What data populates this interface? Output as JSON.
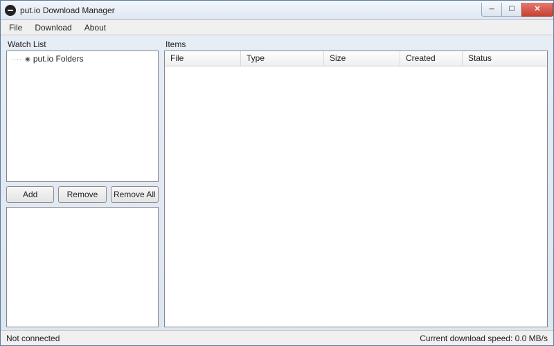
{
  "window": {
    "title": "put.io Download Manager"
  },
  "menu": {
    "file": "File",
    "download": "Download",
    "about": "About"
  },
  "watchlist": {
    "label": "Watch List",
    "root_item": "put.io Folders"
  },
  "buttons": {
    "add": "Add",
    "remove": "Remove",
    "remove_all": "Remove All"
  },
  "items": {
    "label": "Items",
    "columns": {
      "file": "File",
      "type": "Type",
      "size": "Size",
      "created": "Created",
      "status": "Status"
    }
  },
  "status": {
    "connection": "Not connected",
    "speed": "Current download speed: 0.0 MB/s"
  }
}
